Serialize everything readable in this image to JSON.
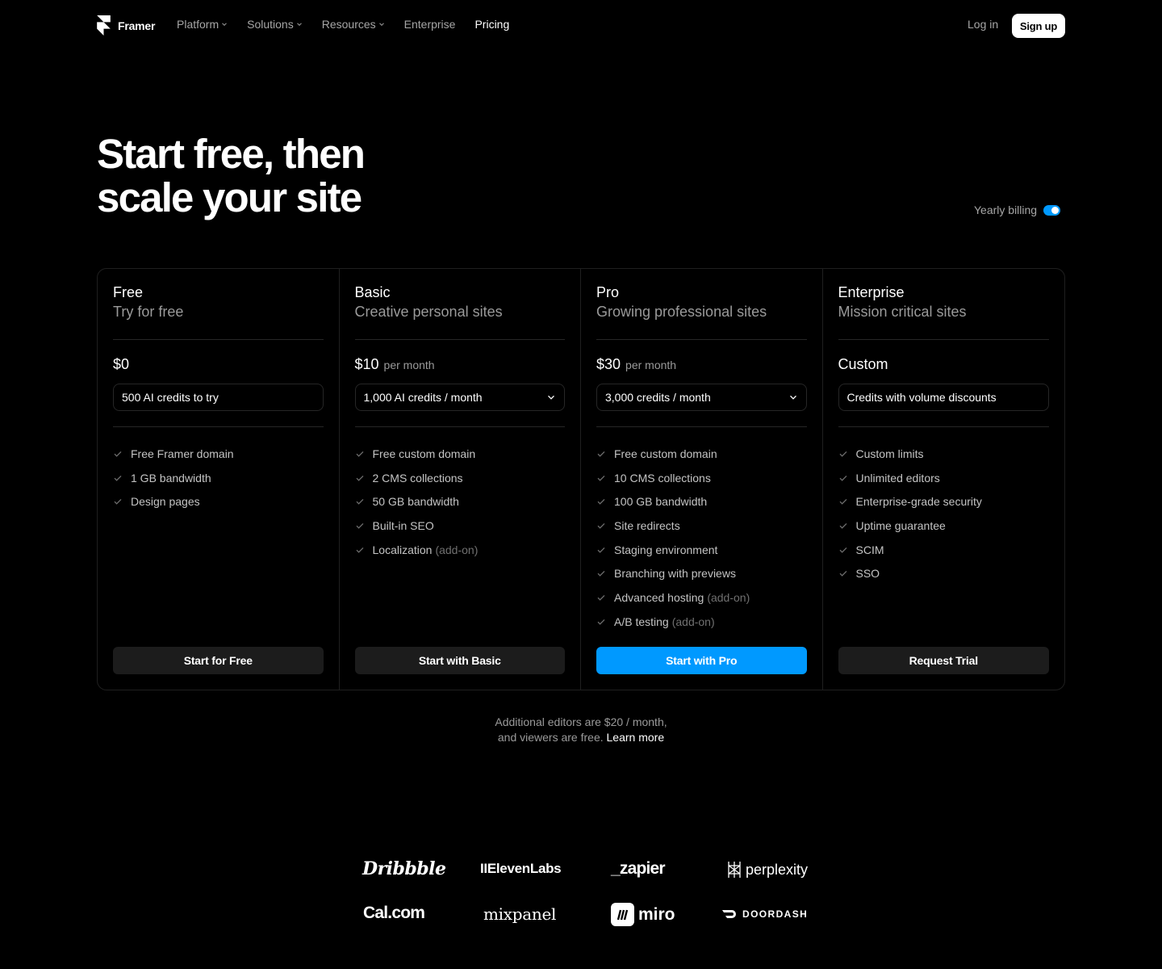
{
  "nav": {
    "brand": "Framer",
    "links": [
      {
        "label": "Platform",
        "dropdown": true
      },
      {
        "label": "Solutions",
        "dropdown": true
      },
      {
        "label": "Resources",
        "dropdown": true
      },
      {
        "label": "Enterprise",
        "dropdown": false
      },
      {
        "label": "Pricing",
        "dropdown": false,
        "active": true
      }
    ],
    "login": "Log in",
    "signup": "Sign up"
  },
  "hero": {
    "line1": "Start free, then",
    "line2": "scale your site"
  },
  "billing": {
    "label": "Yearly billing",
    "enabled": true,
    "accent": "#0099ff"
  },
  "plans": [
    {
      "name": "Free",
      "subtitle": "Try for free",
      "price": "$0",
      "period": "",
      "credits": "500 AI credits to try",
      "credits_dropdown": false,
      "features": [
        {
          "text": "Free Framer domain",
          "addon": ""
        },
        {
          "text": "1 GB bandwidth",
          "addon": ""
        },
        {
          "text": "Design pages",
          "addon": ""
        }
      ],
      "cta": "Start for Free",
      "primary": false
    },
    {
      "name": "Basic",
      "subtitle": "Creative personal sites",
      "price": "$10",
      "period": "per month",
      "credits": "1,000 AI credits / month",
      "credits_dropdown": true,
      "features": [
        {
          "text": "Free custom domain",
          "addon": ""
        },
        {
          "text": "2 CMS collections",
          "addon": ""
        },
        {
          "text": "50 GB bandwidth",
          "addon": ""
        },
        {
          "text": "Built-in SEO",
          "addon": ""
        },
        {
          "text": "Localization",
          "addon": "(add-on)"
        }
      ],
      "cta": "Start with Basic",
      "primary": false
    },
    {
      "name": "Pro",
      "subtitle": "Growing professional sites",
      "price": "$30",
      "period": "per month",
      "credits": "3,000 credits / month",
      "credits_dropdown": true,
      "features": [
        {
          "text": "Free custom domain",
          "addon": ""
        },
        {
          "text": "10 CMS collections",
          "addon": ""
        },
        {
          "text": "100 GB bandwidth",
          "addon": ""
        },
        {
          "text": "Site redirects",
          "addon": ""
        },
        {
          "text": "Staging environment",
          "addon": ""
        },
        {
          "text": "Branching with previews",
          "addon": ""
        },
        {
          "text": "Advanced hosting",
          "addon": "(add-on)"
        },
        {
          "text": "A/B testing",
          "addon": "(add-on)"
        }
      ],
      "cta": "Start with Pro",
      "primary": true
    },
    {
      "name": "Enterprise",
      "subtitle": "Mission critical sites",
      "price": "Custom",
      "period": "",
      "credits": "Credits with volume discounts",
      "credits_dropdown": false,
      "features": [
        {
          "text": "Custom limits",
          "addon": ""
        },
        {
          "text": "Unlimited editors",
          "addon": ""
        },
        {
          "text": "Enterprise-grade security",
          "addon": ""
        },
        {
          "text": "Uptime guarantee",
          "addon": ""
        },
        {
          "text": "SCIM",
          "addon": ""
        },
        {
          "text": "SSO",
          "addon": ""
        }
      ],
      "cta": "Request Trial",
      "primary": false
    }
  ],
  "note": {
    "line1": "Additional editors are $20 / month,",
    "line2": "and viewers are free.",
    "link": "Learn more"
  },
  "logos": {
    "dribbble": "Dribbble",
    "elevenlabs": "IIElevenLabs",
    "zapier": "_zapier",
    "perplexity": "perplexity",
    "calcom": "Cal.com",
    "mixpanel": "mixpanel",
    "miro": "miro",
    "doordash": "DOORDASH"
  }
}
